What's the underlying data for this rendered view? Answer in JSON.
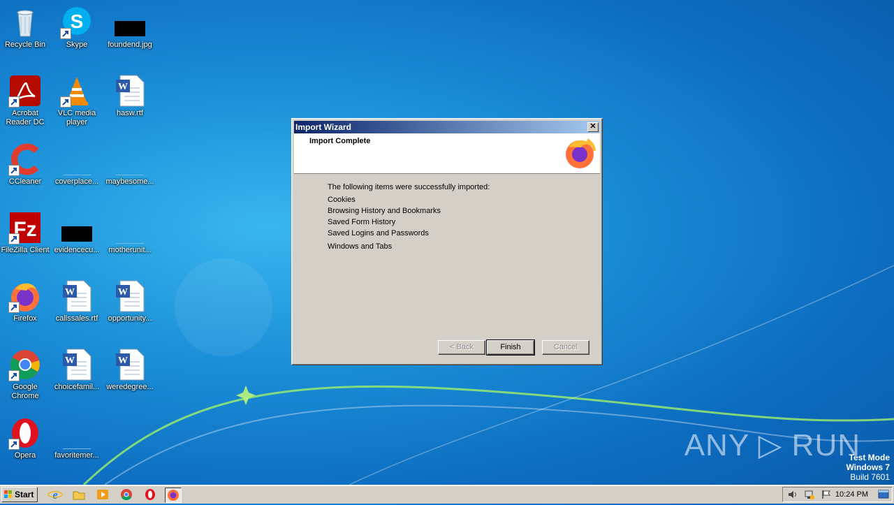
{
  "desktop": {
    "icons": [
      {
        "label": "Recycle Bin"
      },
      {
        "label": "Skype"
      },
      {
        "label": "foundend.jpg"
      },
      {
        "label": "Acrobat Reader DC"
      },
      {
        "label": "VLC media player"
      },
      {
        "label": "hasw.rtf"
      },
      {
        "label": "CCleaner"
      },
      {
        "label": "coverplace..."
      },
      {
        "label": "maybesome..."
      },
      {
        "label": "FileZilla Client"
      },
      {
        "label": "evidencecu..."
      },
      {
        "label": "motherunit..."
      },
      {
        "label": "Firefox"
      },
      {
        "label": "callssales.rtf"
      },
      {
        "label": "opportunity..."
      },
      {
        "label": "Google Chrome"
      },
      {
        "label": "choicefamil..."
      },
      {
        "label": "weredegree..."
      },
      {
        "label": "Opera"
      },
      {
        "label": "favoritemer..."
      }
    ]
  },
  "dialog": {
    "title": "Import Wizard",
    "close_label": "✕",
    "header_title": "Import Complete",
    "intro": "The following items were successfully imported:",
    "items": [
      "Cookies",
      "Browsing History and Bookmarks",
      "Saved Form History",
      "Saved Logins and Passwords",
      "Windows and Tabs"
    ],
    "buttons": {
      "back": "< Back",
      "finish": "Finish",
      "cancel": "Cancel"
    }
  },
  "taskbar": {
    "start_label": "Start",
    "clock": "10:24 PM"
  },
  "watermark": {
    "text": "ANY ▷ RUN"
  },
  "os_notice": {
    "line1": "Test Mode",
    "line2": "Windows 7",
    "line3": "Build 7601"
  }
}
